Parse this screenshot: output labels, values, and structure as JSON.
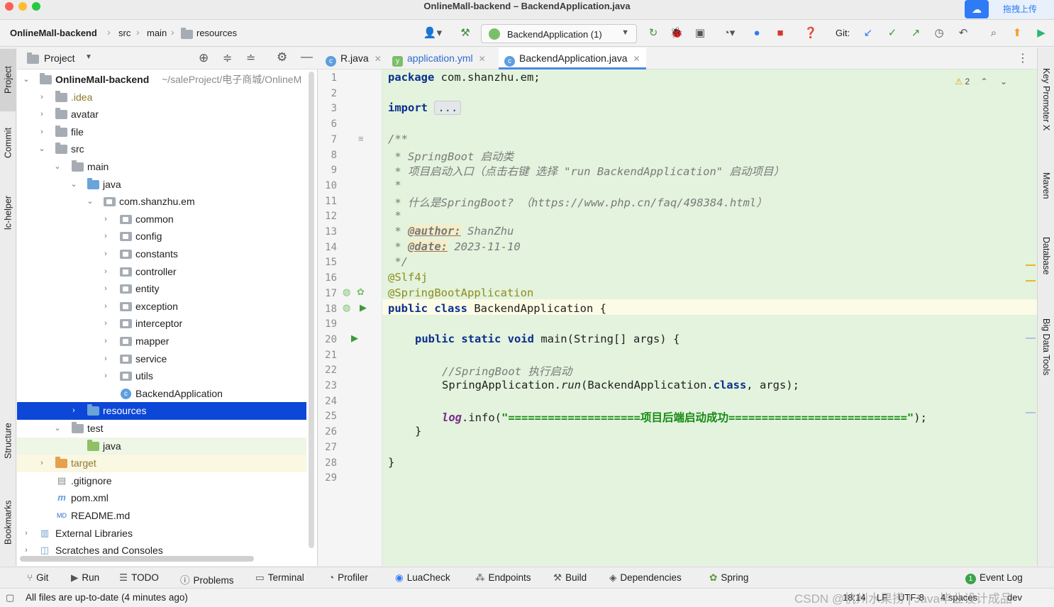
{
  "window": {
    "title": "OnlineMall-backend – BackendApplication.java",
    "upload_label": "拖拽上传"
  },
  "breadcrumbs": [
    "OnlineMall-backend",
    "src",
    "main",
    "resources"
  ],
  "toolbar": {
    "run_config": "BackendApplication (1)",
    "git_label": "Git:"
  },
  "left_stripe": {
    "tabs": [
      "Project",
      "Commit",
      "lc-helper",
      "Structure",
      "Bookmarks"
    ]
  },
  "project_panel": {
    "title": "Project",
    "tree": [
      {
        "label": "OnlineMall-backend",
        "hint": "~/saleProject/电子商城/OnlineM"
      },
      {
        "label": ".idea"
      },
      {
        "label": "avatar"
      },
      {
        "label": "file"
      },
      {
        "label": "src"
      },
      {
        "label": "main"
      },
      {
        "label": "java"
      },
      {
        "label": "com.shanzhu.em"
      },
      {
        "label": "common"
      },
      {
        "label": "config"
      },
      {
        "label": "constants"
      },
      {
        "label": "controller"
      },
      {
        "label": "entity"
      },
      {
        "label": "exception"
      },
      {
        "label": "interceptor"
      },
      {
        "label": "mapper"
      },
      {
        "label": "service"
      },
      {
        "label": "utils"
      },
      {
        "label": "BackendApplication"
      },
      {
        "label": "resources"
      },
      {
        "label": "test"
      },
      {
        "label": "java"
      },
      {
        "label": "target"
      },
      {
        "label": ".gitignore"
      },
      {
        "label": "pom.xml"
      },
      {
        "label": "README.md"
      },
      {
        "label": "External Libraries"
      },
      {
        "label": "Scratches and Consoles"
      }
    ]
  },
  "editor": {
    "tabs": [
      {
        "label": "R.java"
      },
      {
        "label": "application.yml"
      },
      {
        "label": "BackendApplication.java"
      }
    ],
    "line_numbers": [
      "1",
      "2",
      "3",
      "6",
      "7",
      "8",
      "9",
      "10",
      "11",
      "12",
      "13",
      "14",
      "15",
      "16",
      "17",
      "18",
      "19",
      "20",
      "21",
      "22",
      "23",
      "24",
      "25",
      "26",
      "27",
      "28",
      "29"
    ],
    "warning_count": "2",
    "code": {
      "l1_kw": "package",
      "l1_rest": " com.shanzhu.em;",
      "l3_kw": "import",
      "l3_fold": "...",
      "l7": "/**",
      "l8": " * SpringBoot 启动类",
      "l9": " * 项目启动入口（点击右键 选择 \"run BackendApplication\" 启动项目）",
      "l10": " *",
      "l11": " * 什么是SpringBoot? （https://www.php.cn/faq/498384.html）",
      "l12": " *",
      "l13_pre": " * ",
      "l13_tag": "@author:",
      "l13_val": " ShanZhu",
      "l14_pre": " * ",
      "l14_tag": "@date:",
      "l14_val": " 2023-11-10",
      "l15": " */",
      "l16": "@Slf4j",
      "l17": "@SpringBootApplication",
      "l18_kw": "public class",
      "l18_rest": " BackendApplication {",
      "l20_kw": "public static void",
      "l20_rest": " main(String[] args) {",
      "l22": "//SpringBoot 执行启动",
      "l23_a": "SpringApplication.",
      "l23_run": "run",
      "l23_b": "(BackendApplication.",
      "l23_class": "class",
      "l23_c": ", args);",
      "l25_log": "log",
      "l25_a": ".info(",
      "l25_str": "\"====================项目后端启动成功===========================\"",
      "l25_b": ");",
      "l26": "}",
      "l28": "}"
    }
  },
  "right_stripe": {
    "tabs": [
      "Key Promoter X",
      "Maven",
      "Database",
      "Big Data Tools"
    ]
  },
  "bottom_tools": [
    "Git",
    "Run",
    "TODO",
    "Problems",
    "Terminal",
    "Profiler",
    "LuaCheck",
    "Endpoints",
    "Build",
    "Dependencies",
    "Spring",
    "Event Log"
  ],
  "event_log_badge": "1",
  "status": {
    "message": "All files are up-to-date (4 minutes ago)",
    "position": "18:14",
    "line_sep": "LF",
    "encoding": "UTF-8",
    "indent": "4 spaces",
    "branch": "dev",
    "watermark": "CSDN @杭州水果捞 | Java毕业设计成品"
  },
  "colors": {
    "editor_bg": "#e3f3dd",
    "selection": "#0d47d8",
    "keyword": "#0b2e8c",
    "string": "#148a14",
    "annotation": "#8d8d1d"
  }
}
